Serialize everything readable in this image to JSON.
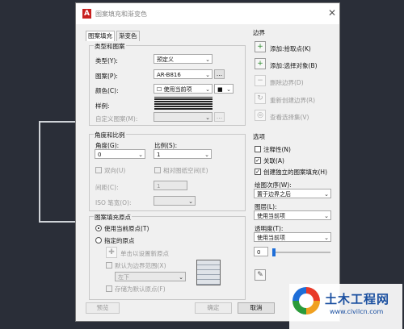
{
  "dialog": {
    "title": "图案填充和渐变色",
    "close_glyph": "✕",
    "app_icon_letter": "A"
  },
  "tabs": [
    "图案填充",
    "渐变色"
  ],
  "type_pattern": {
    "heading": "类型和图案",
    "type_label": "类型(Y):",
    "type_value": "预定义",
    "pattern_label": "图案(P):",
    "pattern_value": "AR-B816",
    "browse": "...",
    "color_label": "颜色(C):",
    "color_value": "☐ 使用当前项",
    "color_swatch": "■",
    "sample_label": "样例:",
    "custom_label": "自定义图案(M):",
    "custom_browse": "..."
  },
  "angle_scale": {
    "heading": "角度和比例",
    "angle_label": "角度(G):",
    "angle_value": "0",
    "scale_label": "比例(S):",
    "scale_value": "1",
    "double_label": "双向(U)",
    "relative_label": "相对图纸空间(E)",
    "spacing_label": "间距(C):",
    "spacing_value": "1",
    "iso_label": "ISO 笔宽(O):"
  },
  "origin": {
    "heading": "图案填充原点",
    "use_current": "使用当前原点(T)",
    "specified": "指定的原点",
    "click_set": "单击以设置新原点",
    "default_boundary": "默认为边界范围(X)",
    "position_value": "左下",
    "store_default": "存储为默认原点(F)"
  },
  "boundary": {
    "heading": "边界",
    "add_pick": "添加:拾取点(K)",
    "add_select": "添加:选择对象(B)",
    "remove": "删除边界(D)",
    "recreate": "重新创建边界(R)",
    "view": "查看选择集(V)"
  },
  "options": {
    "heading": "选项",
    "annotative": "注释性(N)",
    "associative": "关联(A)",
    "separate": "创建独立的图案填充(H)",
    "draw_order_label": "绘图次序(W):",
    "draw_order_value": "置于边界之后",
    "layer_label": "图层(L):",
    "layer_value": "使用当前项",
    "transparency_label": "透明度(T):",
    "transparency_value": "使用当前项",
    "transparency_number": "0",
    "transparency_level": 0
  },
  "footer": {
    "preview": "预览",
    "ok": "确定",
    "cancel": "取消"
  },
  "watermark": {
    "title": "土木工程网",
    "url": "www.civilcn.com"
  },
  "colors": {
    "background": "#2a2e38",
    "dialog": "#f0f0f0",
    "accent": "#1e6ed8",
    "brand": "#c8201f"
  }
}
